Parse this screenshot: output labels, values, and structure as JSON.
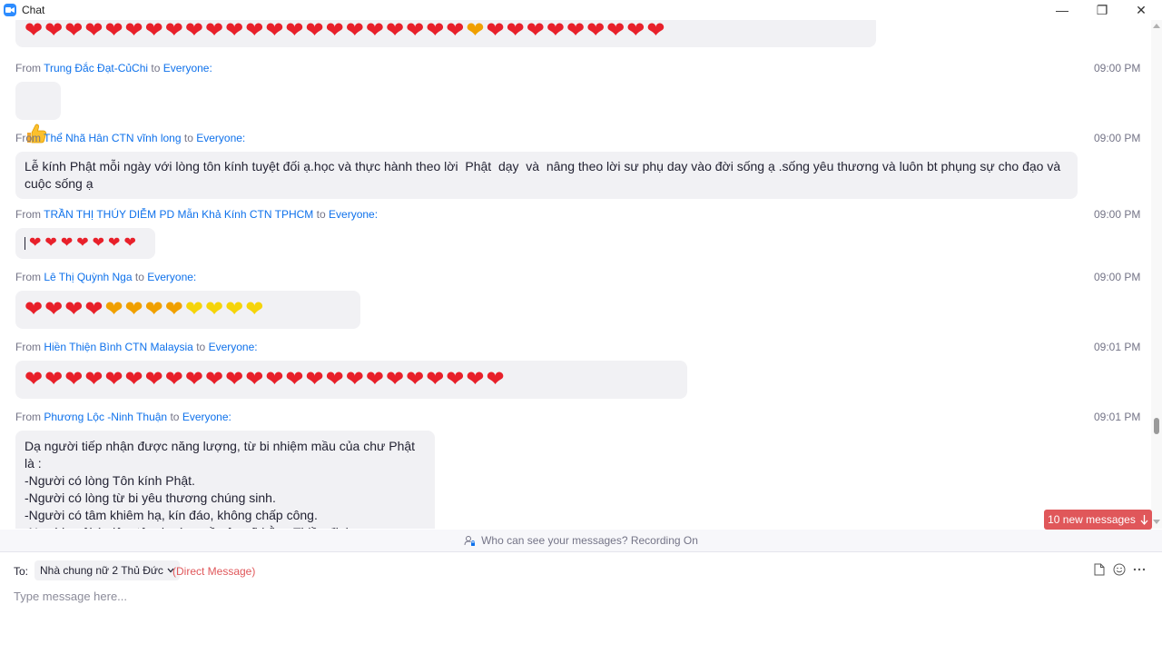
{
  "window": {
    "title": "Chat",
    "controls": {
      "minimize": "—",
      "restore": "❐",
      "close": "✕"
    }
  },
  "messages": [
    {
      "type": "hearts",
      "hearts": [
        "red",
        "red",
        "red",
        "red",
        "red",
        "red",
        "red",
        "red",
        "red",
        "red",
        "red",
        "red",
        "red",
        "red",
        "red",
        "red",
        "red",
        "red",
        "red",
        "red",
        "red",
        "red",
        "orange",
        "red",
        "red",
        "red",
        "red",
        "red",
        "red",
        "red",
        "red",
        "red"
      ]
    },
    {
      "from_prefix": "From",
      "sender": "Trung Đắc Đạt-CủChi",
      "to_prefix": "to",
      "recipient": "Everyone:",
      "time": "09:00 PM",
      "type": "thumb"
    },
    {
      "from_prefix": "From",
      "sender": "Thể Nhã Hân CTN vĩnh long",
      "to_prefix": "to",
      "recipient": "Everyone:",
      "time": "09:00 PM",
      "type": "text",
      "text": "Lễ kính Phật mỗi ngày với lòng tôn kính tuyệt đối ạ.học và thực hành theo lời  Phật  dạy  và  nâng theo lời sư phụ day vào đời sống ạ .sống yêu thương và luôn bt phụng sự cho đạo và cuộc sống ạ"
    },
    {
      "from_prefix": "From",
      "sender": "TRẦN THỊ THÚY DIỄM PD Mẫn Khả Kính CTN TPHCM",
      "to_prefix": "to",
      "recipient": "Everyone:",
      "time": "09:00 PM",
      "type": "small-hearts",
      "hearts": [
        "red",
        "red",
        "red",
        "red",
        "red",
        "red",
        "red"
      ]
    },
    {
      "from_prefix": "From",
      "sender": "Lê Thị Quỳnh Nga",
      "to_prefix": "to",
      "recipient": "Everyone:",
      "time": "09:00 PM",
      "type": "hearts",
      "hearts": [
        "red",
        "red",
        "red",
        "red",
        "orange",
        "orange",
        "orange",
        "orange",
        "yellow",
        "yellow",
        "yellow",
        "yellow"
      ]
    },
    {
      "from_prefix": "From",
      "sender": "Hiền Thiện Bình  CTN Malaysia",
      "to_prefix": "to",
      "recipient": "Everyone:",
      "time": "09:01 PM",
      "type": "hearts",
      "hearts": [
        "red",
        "red",
        "red",
        "red",
        "red",
        "red",
        "red",
        "red",
        "red",
        "red",
        "red",
        "red",
        "red",
        "red",
        "red",
        "red",
        "red",
        "red",
        "red",
        "red",
        "red",
        "red",
        "red",
        "red"
      ]
    },
    {
      "from_prefix": "From",
      "sender": "Phương Lộc -Ninh Thuận",
      "to_prefix": "to",
      "recipient": "Everyone:",
      "time": "09:01 PM",
      "type": "text",
      "text": "Dạ người tiếp nhận được năng lượng, từ bi nhiệm mầu của chư Phật là :\n-Người có lòng Tôn kính Phật.\n-Người có lòng từ bi yêu thương chúng sinh.\n-Người có tâm khiêm hạ, kín đáo, không chấp công.\n-Người nuôi ý niệm tâm hướng về vô ngã bằng Thiền định ạ"
    }
  ],
  "new_messages": {
    "label": "10 new messages",
    "icon": "arrow-down-icon"
  },
  "privacy": {
    "text": "Who can see your messages? Recording On",
    "icon": "person-lock-icon"
  },
  "compose": {
    "to_label": "To:",
    "recipient": "Nhà chung nữ 2 Thủ Đức",
    "direct_label": "(Direct Message)",
    "placeholder": "Type message here..."
  },
  "colors": {
    "accent": "#0e71eb",
    "alert": "#e0575a",
    "bubble": "#f1f1f4",
    "heart_red": "#e8202a",
    "heart_orange": "#f0a000",
    "heart_yellow": "#f5d40a"
  }
}
